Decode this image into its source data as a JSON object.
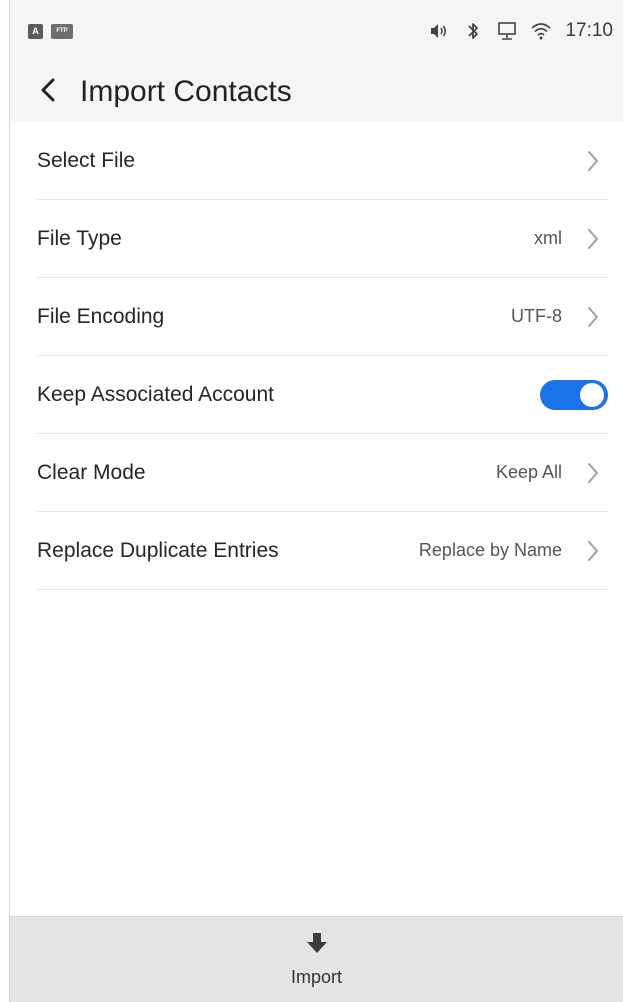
{
  "status_bar": {
    "notif_a_label": "A",
    "notif_ftp_label": "FTP",
    "time": "17:10",
    "icons": [
      "volume-icon",
      "bluetooth-icon",
      "network-icon",
      "wifi-icon"
    ]
  },
  "header": {
    "title": "Import Contacts",
    "back_icon": "chevron-left-icon"
  },
  "settings": {
    "select_file": {
      "label": "Select File"
    },
    "file_type": {
      "label": "File Type",
      "value": "xml"
    },
    "file_encoding": {
      "label": "File Encoding",
      "value": "UTF-8"
    },
    "keep_account": {
      "label": "Keep Associated Account",
      "enabled": true
    },
    "clear_mode": {
      "label": "Clear Mode",
      "value": "Keep All"
    },
    "replace_duplicates": {
      "label": "Replace Duplicate Entries",
      "value": "Replace by Name"
    }
  },
  "footer": {
    "import_label": "Import",
    "import_icon": "arrow-down-icon"
  },
  "colors": {
    "accent": "#1a73e8",
    "header_bg": "#f4f5f7",
    "footer_bg": "#e4e4e4",
    "divider": "#e6e6e6"
  }
}
